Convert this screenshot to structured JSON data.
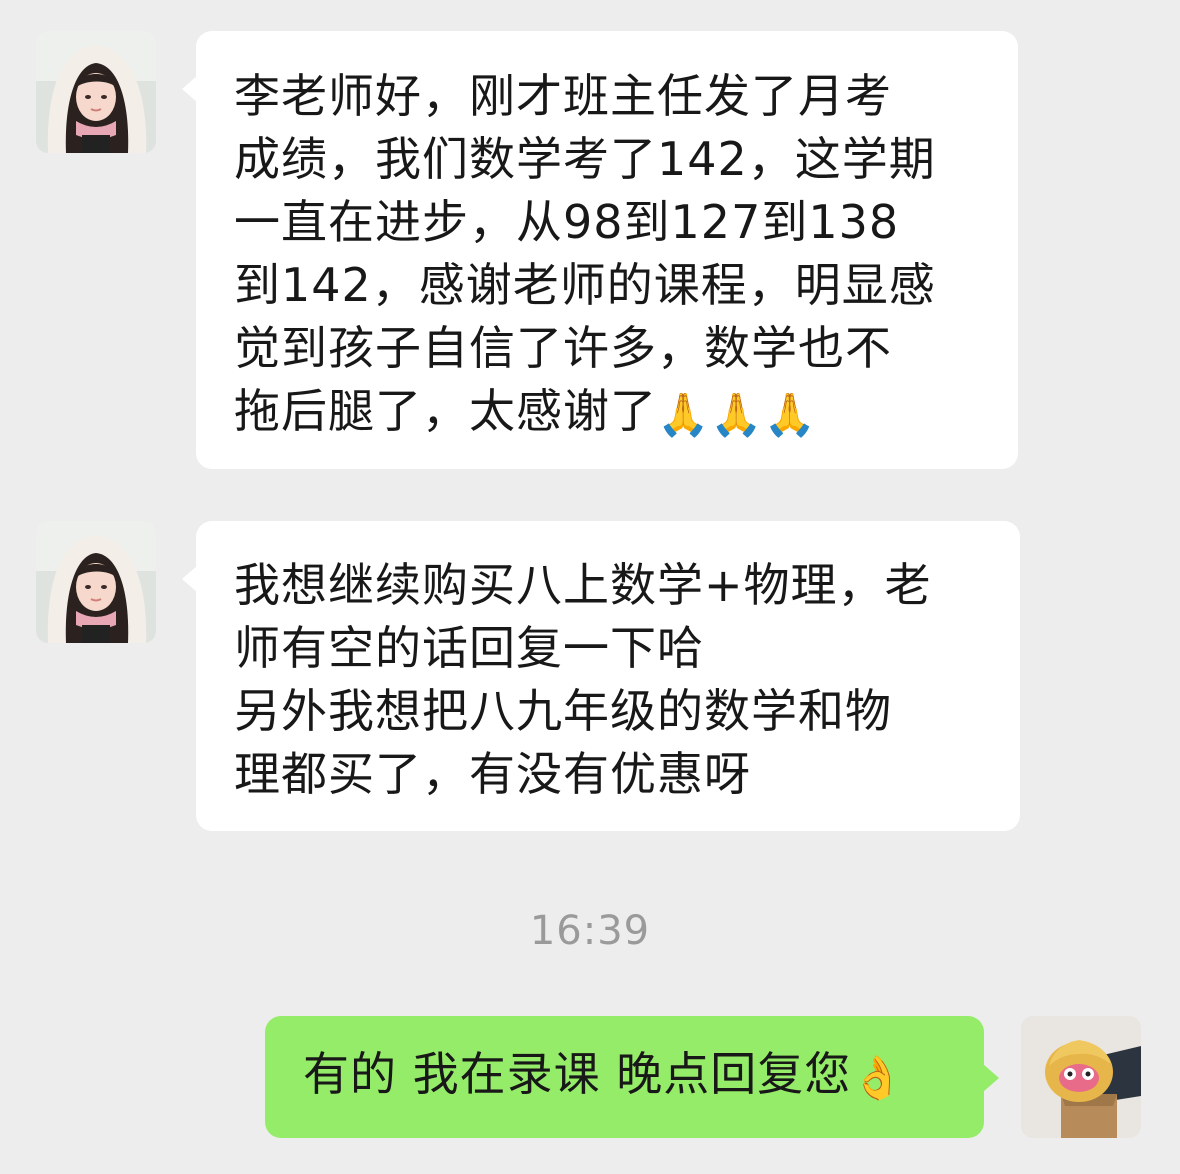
{
  "messages": [
    {
      "direction": "incoming",
      "sender_avatar": "girl-avatar",
      "lines": [
        "李老师好，刚才班主任发了月考",
        "成绩，我们数学考了142，这学期",
        "一直在进步，从98到127到138",
        "到142，感谢老师的课程，明显感",
        "觉到孩子自信了许多，数学也不",
        "拖后腿了，太感谢了"
      ],
      "trailing_emoji": "🙏🙏🙏"
    },
    {
      "direction": "incoming",
      "sender_avatar": "girl-avatar",
      "lines": [
        "我想继续购买八上数学+物理，老",
        "师有空的话回复一下哈",
        "另外我想把八九年级的数学和物",
        "理都买了，有没有优惠呀"
      ]
    },
    {
      "direction": "outgoing",
      "sender_avatar": "toy-avatar",
      "text": "有的 我在录课 晚点回复您",
      "trailing_emoji": "👌"
    }
  ],
  "timestamp": "16:39",
  "colors": {
    "background": "#ededed",
    "incoming_bubble": "#ffffff",
    "outgoing_bubble": "#95ec69",
    "timestamp": "#9a9a9a"
  }
}
